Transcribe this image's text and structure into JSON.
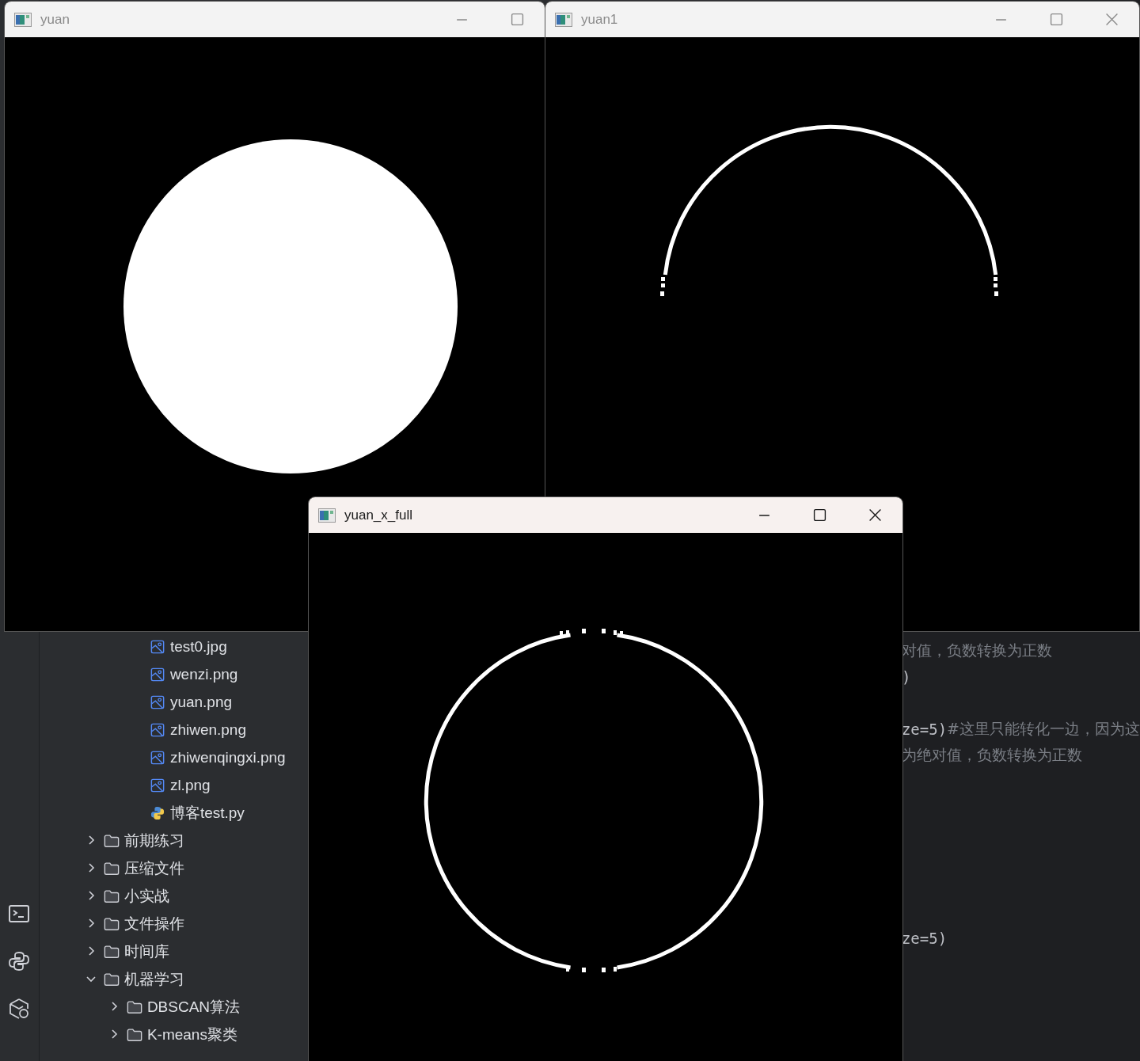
{
  "file_tree": [
    {
      "kind": "continued",
      "children": [
        {
          "kind": "continued",
          "children": [
            {
              "kind": "image",
              "name": "test0.jpg"
            },
            {
              "kind": "image",
              "name": "wenzi.png"
            },
            {
              "kind": "image",
              "name": "yuan.png"
            },
            {
              "kind": "image",
              "name": "zhiwen.png"
            },
            {
              "kind": "image",
              "name": "zhiwenqingxi.png"
            },
            {
              "kind": "image",
              "name": "zl.png"
            },
            {
              "kind": "python",
              "name": "博客test.py"
            }
          ]
        }
      ]
    },
    {
      "kind": "folder",
      "name": "前期练习",
      "expanded": false
    },
    {
      "kind": "folder",
      "name": "压缩文件",
      "expanded": false
    },
    {
      "kind": "folder",
      "name": "小实战",
      "expanded": false
    },
    {
      "kind": "folder",
      "name": "文件操作",
      "expanded": false
    },
    {
      "kind": "folder",
      "name": "时间库",
      "expanded": false
    },
    {
      "kind": "folder",
      "name": "机器学习",
      "expanded": true,
      "children": [
        {
          "kind": "folder",
          "name": "DBSCAN算法",
          "expanded": false
        },
        {
          "kind": "folder",
          "name": "K-means聚类",
          "expanded": false
        }
      ]
    }
  ],
  "code_blocks": [
    [
      {
        "comment": "对值，负数转换为正数"
      },
      {
        "code": ")"
      }
    ],
    [
      {
        "code": "ze=5)",
        "comment": "#这里只能转化一边，因为这"
      },
      {
        "comment": "为绝对值，负数转换为正数"
      }
    ],
    [
      {
        "code": "ze=5)"
      }
    ]
  ],
  "windows": [
    {
      "title": "yuan",
      "active": false,
      "kind": "filled_circle",
      "controls": [
        {
          "kind": "minimize"
        },
        {
          "kind": "maximize"
        }
      ]
    },
    {
      "title": "yuan1",
      "active": false,
      "kind": "arc",
      "controls": [
        {
          "kind": "minimize"
        },
        {
          "kind": "maximize"
        },
        {
          "kind": "close"
        }
      ]
    },
    {
      "title": "yuan_x_full",
      "active": true,
      "kind": "ring",
      "controls": [
        {
          "kind": "minimize"
        },
        {
          "kind": "maximize"
        },
        {
          "kind": "close"
        }
      ]
    }
  ]
}
